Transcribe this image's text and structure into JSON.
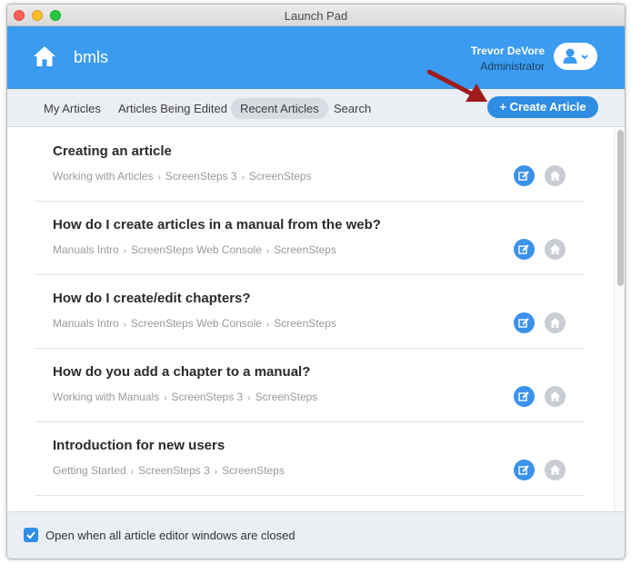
{
  "window": {
    "title": "Launch Pad"
  },
  "header": {
    "app_name": "bmls",
    "user_name": "Trevor DeVore",
    "user_role": "Administrator",
    "home_icon": "home-icon",
    "user_icon": "user-icon"
  },
  "tabs": [
    {
      "label": "My Articles",
      "active": false
    },
    {
      "label": "Articles Being Edited",
      "active": false
    },
    {
      "label": "Recent Articles",
      "active": true
    },
    {
      "label": "Search",
      "active": false
    }
  ],
  "create_button": {
    "label": "Create Article",
    "icon": "plus-icon"
  },
  "articles": [
    {
      "title": "Creating an article",
      "crumbs": [
        "Working with Articles",
        "ScreenSteps 3",
        "ScreenSteps"
      ]
    },
    {
      "title": "How do I create articles in a manual from the web?",
      "crumbs": [
        "Manuals Intro",
        "ScreenSteps Web Console",
        "ScreenSteps"
      ]
    },
    {
      "title": "How do I create/edit chapters?",
      "crumbs": [
        "Manuals Intro",
        "ScreenSteps Web Console",
        "ScreenSteps"
      ]
    },
    {
      "title": "How do you add a chapter to a manual?",
      "crumbs": [
        "Working with Manuals",
        "ScreenSteps 3",
        "ScreenSteps"
      ]
    },
    {
      "title": "Introduction for new users",
      "crumbs": [
        "Getting Started",
        "ScreenSteps 3",
        "ScreenSteps"
      ]
    }
  ],
  "footer": {
    "checkbox_checked": true,
    "label": "Open when all article editor windows are closed"
  },
  "colors": {
    "accent": "#3a9bf0",
    "button": "#2f8de4",
    "arrow": "#a01c1c"
  }
}
